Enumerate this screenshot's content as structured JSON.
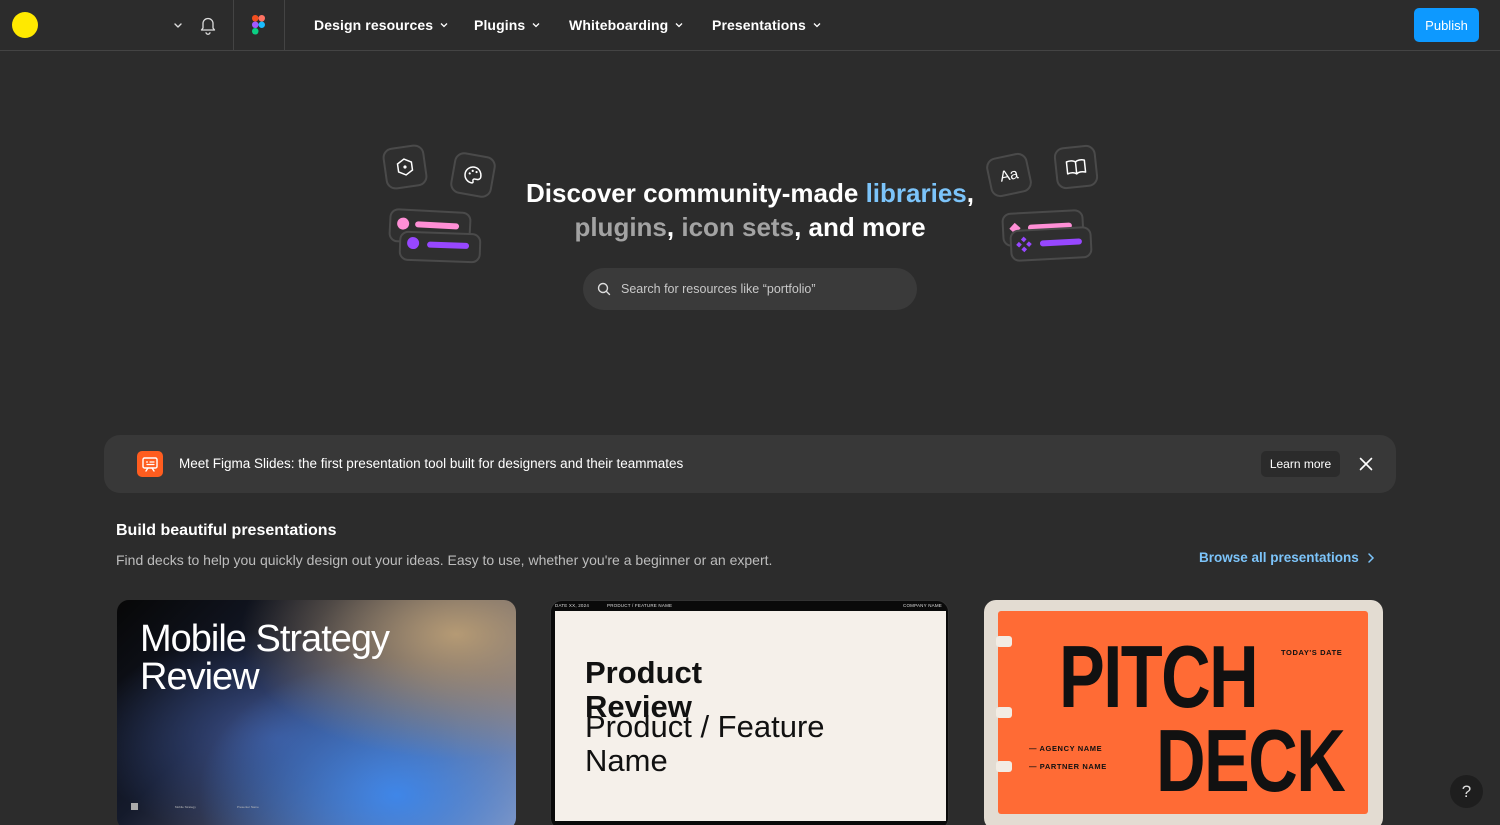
{
  "topbar": {
    "nav": [
      {
        "label": "Design resources"
      },
      {
        "label": "Plugins"
      },
      {
        "label": "Whiteboarding"
      },
      {
        "label": "Presentations"
      }
    ],
    "publish_label": "Publish"
  },
  "hero": {
    "title_part1": "Discover community-made ",
    "title_libraries": "libraries",
    "title_comma1": ",",
    "title_plugins": "plugins",
    "title_comma2": ", ",
    "title_iconsets": "icon sets",
    "title_rest": ", and more",
    "search_placeholder": "Search for resources like “portfolio”",
    "deco_font_label": "Aa"
  },
  "banner": {
    "text": "Meet Figma Slides: the first presentation tool built for designers and their teammates",
    "learn_more": "Learn more"
  },
  "section": {
    "title": "Build beautiful presentations",
    "subtitle": "Find decks to help you quickly design out your ideas. Easy to use, whether you're a beginner or an expert.",
    "browse_label": "Browse all presentations"
  },
  "cards": [
    {
      "title": "Mobile Strategy Review",
      "footer_a": "Mobile Strategy",
      "footer_b": "Presenter Name"
    },
    {
      "top_left": "DATE XX, 2024",
      "top_mid": "PRODUCT / FEATURE NAME",
      "top_right": "COMPANY NAME",
      "title": "Product Review",
      "subtitle": "Product / Feature Name"
    },
    {
      "line1": "PITCH",
      "line2": "DECK",
      "date": "TODAY'S DATE",
      "agency": "— AGENCY NAME",
      "partner": "— PARTNER NAME"
    }
  ],
  "help_label": "?",
  "colors": {
    "accent": "#0d99ff",
    "link": "#7cc4fa",
    "banner_icon": "#ff5d1f",
    "avatar": "#ffe900"
  }
}
